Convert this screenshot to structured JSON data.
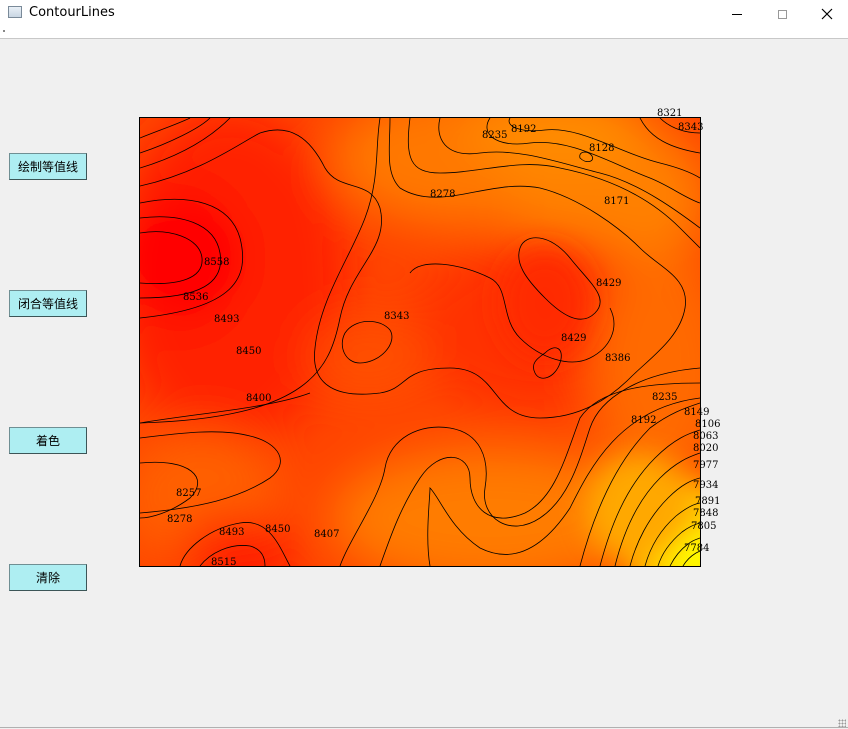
{
  "window": {
    "title": "ContourLines",
    "icon": "app-window-icon",
    "controls": [
      "minimize-icon",
      "maximize-icon",
      "close-icon"
    ]
  },
  "sidebar": {
    "buttons": [
      {
        "label": "绘制等值线"
      },
      {
        "label": "闭合等值线"
      },
      {
        "label": "着色"
      },
      {
        "label": "清除"
      }
    ]
  },
  "contour_labels": [
    "8321",
    "8343",
    "8235",
    "8192",
    "8128",
    "8278",
    "8171",
    "8558",
    "8536",
    "8493",
    "8450",
    "8343",
    "8429",
    "8429",
    "8386",
    "8400",
    "8235",
    "8149",
    "8192",
    "8106",
    "8063",
    "8020",
    "7977",
    "7934",
    "7891",
    "7848",
    "7805",
    "7784",
    "8257",
    "8278",
    "8493",
    "8450",
    "8407",
    "8515"
  ],
  "colors": {
    "hot": "#ff0000",
    "mid": "#ff5a00",
    "warm": "#ff8c00",
    "cool": "#ffff00",
    "button_bg": "#aeeef2"
  }
}
